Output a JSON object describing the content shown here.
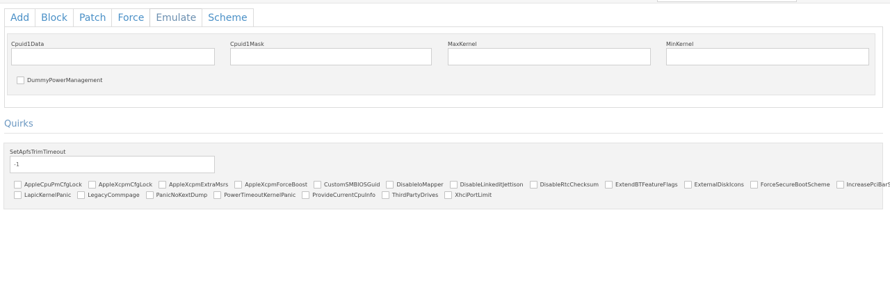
{
  "tabs": [
    {
      "label": "Add"
    },
    {
      "label": "Block"
    },
    {
      "label": "Patch"
    },
    {
      "label": "Force"
    },
    {
      "label": "Emulate",
      "active": true
    },
    {
      "label": "Scheme"
    }
  ],
  "emulate": {
    "fields": [
      {
        "label": "Cpuid1Data",
        "value": ""
      },
      {
        "label": "Cpuid1Mask",
        "value": ""
      },
      {
        "label": "MaxKernel",
        "value": ""
      },
      {
        "label": "MinKernel",
        "value": ""
      }
    ],
    "dummy_power_management": {
      "label": "DummyPowerManagement",
      "checked": false
    }
  },
  "quirks": {
    "title": "Quirks",
    "apfs_trim": {
      "label": "SetApfsTrimTimeout",
      "value": "-1"
    },
    "row1": [
      "AppleCpuPmCfgLock",
      "AppleXcpmCfgLock",
      "AppleXcpmExtraMsrs",
      "AppleXcpmForceBoost",
      "CustomSMBIOSGuid",
      "DisableIoMapper",
      "DisableLinkeditJettison",
      "DisableRtcChecksum",
      "ExtendBTFeatureFlags",
      "ExternalDiskIcons",
      "ForceSecureBootScheme",
      "IncreasePciBarSize"
    ],
    "row2": [
      "LapicKernelPanic",
      "LegacyCommpage",
      "PanicNoKextDump",
      "PowerTimeoutKernelPanic",
      "ProvideCurrentCpuInfo",
      "ThirdPartyDrives",
      "XhciPortLimit"
    ]
  },
  "colors": {
    "accent": "#4a90c7",
    "panel_bg": "#f3f3f3",
    "border": "#dcdcdc"
  }
}
